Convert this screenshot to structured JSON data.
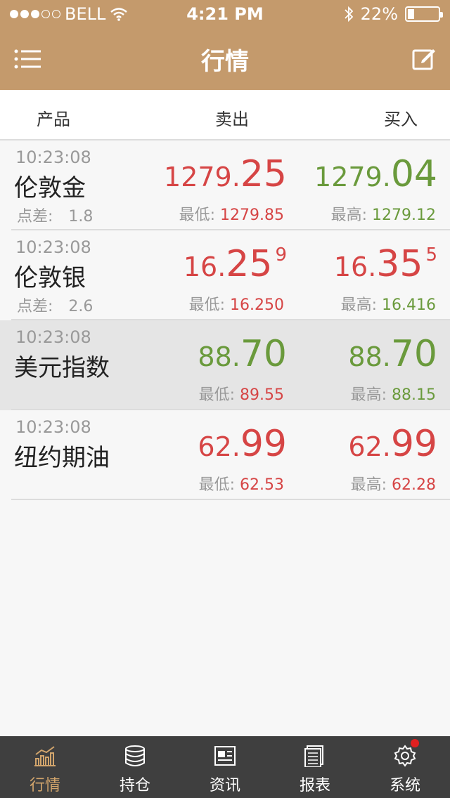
{
  "status_bar": {
    "carrier": "BELL",
    "time": "4:21 PM",
    "battery": "22%",
    "battery_level": 0.22
  },
  "nav": {
    "title": "行情"
  },
  "columns": {
    "product": "产品",
    "sell": "卖出",
    "buy": "买入"
  },
  "quotes": [
    {
      "time": "10:23:08",
      "name": "伦敦金",
      "spread_label": "点差:",
      "spread": "1.8",
      "sell": {
        "main": "1279.",
        "big": "25",
        "sup": "",
        "color": "red"
      },
      "buy": {
        "main": "1279.",
        "big": "04",
        "sup": "",
        "color": "green"
      },
      "low_label": "最低:",
      "low": "1279.85",
      "low_color": "red",
      "high_label": "最高:",
      "high": "1279.12",
      "high_color": "green"
    },
    {
      "time": "10:23:08",
      "name": "伦敦银",
      "spread_label": "点差:",
      "spread": "2.6",
      "sell": {
        "main": "16.",
        "big": "25",
        "sup": "9",
        "color": "red"
      },
      "buy": {
        "main": "16.",
        "big": "35",
        "sup": "5",
        "color": "red"
      },
      "low_label": "最低:",
      "low": "16.250",
      "low_color": "red",
      "high_label": "最高:",
      "high": "16.416",
      "high_color": "green"
    },
    {
      "time": "10:23:08",
      "name": "美元指数",
      "spread_label": "",
      "spread": "",
      "sell": {
        "main": "88.",
        "big": "70",
        "sup": "",
        "color": "green"
      },
      "buy": {
        "main": "88.",
        "big": "70",
        "sup": "",
        "color": "green"
      },
      "low_label": "最低:",
      "low": "89.55",
      "low_color": "red",
      "high_label": "最高:",
      "high": "88.15",
      "high_color": "green"
    },
    {
      "time": "10:23:08",
      "name": "纽约期油",
      "spread_label": "",
      "spread": "",
      "sell": {
        "main": "62.",
        "big": "99",
        "sup": "",
        "color": "red"
      },
      "buy": {
        "main": "62.",
        "big": "99",
        "sup": "",
        "color": "red"
      },
      "low_label": "最低:",
      "low": "62.53",
      "low_color": "red",
      "high_label": "最高:",
      "high": "62.28",
      "high_color": "red"
    }
  ],
  "tabs": [
    {
      "label": "行情",
      "icon": "chart-icon",
      "active": true
    },
    {
      "label": "持仓",
      "icon": "database-icon",
      "active": false
    },
    {
      "label": "资讯",
      "icon": "news-icon",
      "active": false
    },
    {
      "label": "报表",
      "icon": "report-icon",
      "active": false
    },
    {
      "label": "系统",
      "icon": "gear-icon",
      "active": false,
      "badge": true
    }
  ],
  "colors": {
    "brand": "#c49a6c",
    "red": "#d64545",
    "green": "#6a9a3c",
    "tab_active": "#d2a56c",
    "tab_bg": "#3f3f3f"
  }
}
